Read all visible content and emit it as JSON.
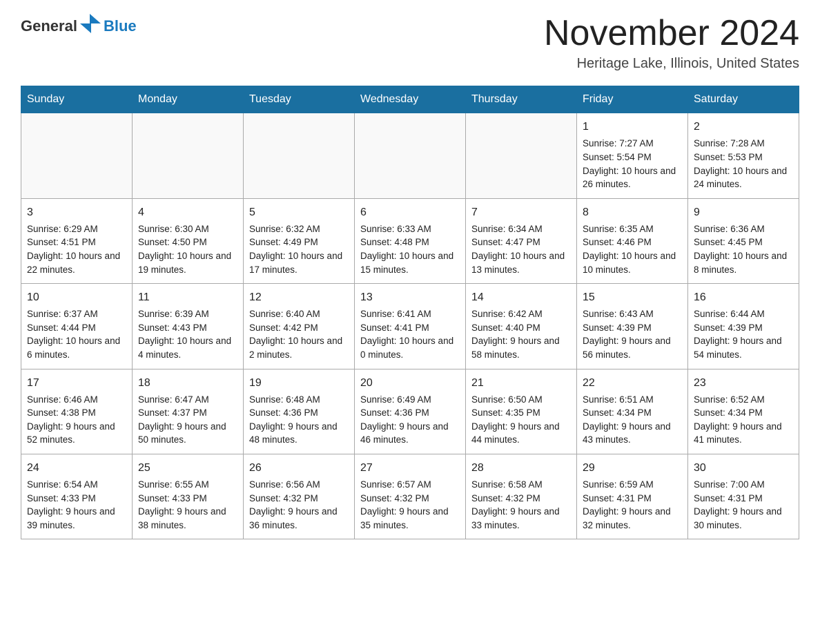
{
  "header": {
    "logo": {
      "general": "General",
      "arrow": "▶",
      "blue": "Blue"
    },
    "title": "November 2024",
    "subtitle": "Heritage Lake, Illinois, United States"
  },
  "weekdays": [
    "Sunday",
    "Monday",
    "Tuesday",
    "Wednesday",
    "Thursday",
    "Friday",
    "Saturday"
  ],
  "weeks": [
    [
      {
        "day": "",
        "sunrise": "",
        "sunset": "",
        "daylight": "",
        "empty": true
      },
      {
        "day": "",
        "sunrise": "",
        "sunset": "",
        "daylight": "",
        "empty": true
      },
      {
        "day": "",
        "sunrise": "",
        "sunset": "",
        "daylight": "",
        "empty": true
      },
      {
        "day": "",
        "sunrise": "",
        "sunset": "",
        "daylight": "",
        "empty": true
      },
      {
        "day": "",
        "sunrise": "",
        "sunset": "",
        "daylight": "",
        "empty": true
      },
      {
        "day": "1",
        "sunrise": "Sunrise: 7:27 AM",
        "sunset": "Sunset: 5:54 PM",
        "daylight": "Daylight: 10 hours and 26 minutes.",
        "empty": false
      },
      {
        "day": "2",
        "sunrise": "Sunrise: 7:28 AM",
        "sunset": "Sunset: 5:53 PM",
        "daylight": "Daylight: 10 hours and 24 minutes.",
        "empty": false
      }
    ],
    [
      {
        "day": "3",
        "sunrise": "Sunrise: 6:29 AM",
        "sunset": "Sunset: 4:51 PM",
        "daylight": "Daylight: 10 hours and 22 minutes.",
        "empty": false
      },
      {
        "day": "4",
        "sunrise": "Sunrise: 6:30 AM",
        "sunset": "Sunset: 4:50 PM",
        "daylight": "Daylight: 10 hours and 19 minutes.",
        "empty": false
      },
      {
        "day": "5",
        "sunrise": "Sunrise: 6:32 AM",
        "sunset": "Sunset: 4:49 PM",
        "daylight": "Daylight: 10 hours and 17 minutes.",
        "empty": false
      },
      {
        "day": "6",
        "sunrise": "Sunrise: 6:33 AM",
        "sunset": "Sunset: 4:48 PM",
        "daylight": "Daylight: 10 hours and 15 minutes.",
        "empty": false
      },
      {
        "day": "7",
        "sunrise": "Sunrise: 6:34 AM",
        "sunset": "Sunset: 4:47 PM",
        "daylight": "Daylight: 10 hours and 13 minutes.",
        "empty": false
      },
      {
        "day": "8",
        "sunrise": "Sunrise: 6:35 AM",
        "sunset": "Sunset: 4:46 PM",
        "daylight": "Daylight: 10 hours and 10 minutes.",
        "empty": false
      },
      {
        "day": "9",
        "sunrise": "Sunrise: 6:36 AM",
        "sunset": "Sunset: 4:45 PM",
        "daylight": "Daylight: 10 hours and 8 minutes.",
        "empty": false
      }
    ],
    [
      {
        "day": "10",
        "sunrise": "Sunrise: 6:37 AM",
        "sunset": "Sunset: 4:44 PM",
        "daylight": "Daylight: 10 hours and 6 minutes.",
        "empty": false
      },
      {
        "day": "11",
        "sunrise": "Sunrise: 6:39 AM",
        "sunset": "Sunset: 4:43 PM",
        "daylight": "Daylight: 10 hours and 4 minutes.",
        "empty": false
      },
      {
        "day": "12",
        "sunrise": "Sunrise: 6:40 AM",
        "sunset": "Sunset: 4:42 PM",
        "daylight": "Daylight: 10 hours and 2 minutes.",
        "empty": false
      },
      {
        "day": "13",
        "sunrise": "Sunrise: 6:41 AM",
        "sunset": "Sunset: 4:41 PM",
        "daylight": "Daylight: 10 hours and 0 minutes.",
        "empty": false
      },
      {
        "day": "14",
        "sunrise": "Sunrise: 6:42 AM",
        "sunset": "Sunset: 4:40 PM",
        "daylight": "Daylight: 9 hours and 58 minutes.",
        "empty": false
      },
      {
        "day": "15",
        "sunrise": "Sunrise: 6:43 AM",
        "sunset": "Sunset: 4:39 PM",
        "daylight": "Daylight: 9 hours and 56 minutes.",
        "empty": false
      },
      {
        "day": "16",
        "sunrise": "Sunrise: 6:44 AM",
        "sunset": "Sunset: 4:39 PM",
        "daylight": "Daylight: 9 hours and 54 minutes.",
        "empty": false
      }
    ],
    [
      {
        "day": "17",
        "sunrise": "Sunrise: 6:46 AM",
        "sunset": "Sunset: 4:38 PM",
        "daylight": "Daylight: 9 hours and 52 minutes.",
        "empty": false
      },
      {
        "day": "18",
        "sunrise": "Sunrise: 6:47 AM",
        "sunset": "Sunset: 4:37 PM",
        "daylight": "Daylight: 9 hours and 50 minutes.",
        "empty": false
      },
      {
        "day": "19",
        "sunrise": "Sunrise: 6:48 AM",
        "sunset": "Sunset: 4:36 PM",
        "daylight": "Daylight: 9 hours and 48 minutes.",
        "empty": false
      },
      {
        "day": "20",
        "sunrise": "Sunrise: 6:49 AM",
        "sunset": "Sunset: 4:36 PM",
        "daylight": "Daylight: 9 hours and 46 minutes.",
        "empty": false
      },
      {
        "day": "21",
        "sunrise": "Sunrise: 6:50 AM",
        "sunset": "Sunset: 4:35 PM",
        "daylight": "Daylight: 9 hours and 44 minutes.",
        "empty": false
      },
      {
        "day": "22",
        "sunrise": "Sunrise: 6:51 AM",
        "sunset": "Sunset: 4:34 PM",
        "daylight": "Daylight: 9 hours and 43 minutes.",
        "empty": false
      },
      {
        "day": "23",
        "sunrise": "Sunrise: 6:52 AM",
        "sunset": "Sunset: 4:34 PM",
        "daylight": "Daylight: 9 hours and 41 minutes.",
        "empty": false
      }
    ],
    [
      {
        "day": "24",
        "sunrise": "Sunrise: 6:54 AM",
        "sunset": "Sunset: 4:33 PM",
        "daylight": "Daylight: 9 hours and 39 minutes.",
        "empty": false
      },
      {
        "day": "25",
        "sunrise": "Sunrise: 6:55 AM",
        "sunset": "Sunset: 4:33 PM",
        "daylight": "Daylight: 9 hours and 38 minutes.",
        "empty": false
      },
      {
        "day": "26",
        "sunrise": "Sunrise: 6:56 AM",
        "sunset": "Sunset: 4:32 PM",
        "daylight": "Daylight: 9 hours and 36 minutes.",
        "empty": false
      },
      {
        "day": "27",
        "sunrise": "Sunrise: 6:57 AM",
        "sunset": "Sunset: 4:32 PM",
        "daylight": "Daylight: 9 hours and 35 minutes.",
        "empty": false
      },
      {
        "day": "28",
        "sunrise": "Sunrise: 6:58 AM",
        "sunset": "Sunset: 4:32 PM",
        "daylight": "Daylight: 9 hours and 33 minutes.",
        "empty": false
      },
      {
        "day": "29",
        "sunrise": "Sunrise: 6:59 AM",
        "sunset": "Sunset: 4:31 PM",
        "daylight": "Daylight: 9 hours and 32 minutes.",
        "empty": false
      },
      {
        "day": "30",
        "sunrise": "Sunrise: 7:00 AM",
        "sunset": "Sunset: 4:31 PM",
        "daylight": "Daylight: 9 hours and 30 minutes.",
        "empty": false
      }
    ]
  ]
}
